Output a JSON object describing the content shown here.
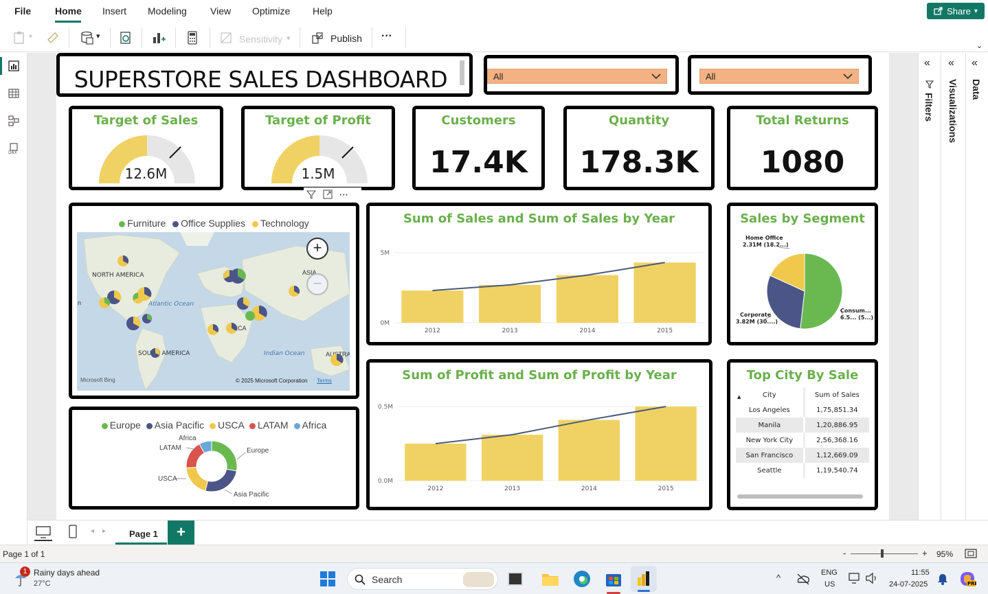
{
  "menubar": {
    "items": [
      "File",
      "Home",
      "Insert",
      "Modeling",
      "View",
      "Optimize",
      "Help"
    ],
    "active": "Home",
    "share_label": "Share"
  },
  "ribbon": {
    "sensitivity_label": "Sensitivity",
    "publish_label": "Publish",
    "more_label": "···"
  },
  "dashboard": {
    "title": "SUPERSTORE SALES DASHBOARD",
    "slicer1_value": "All",
    "slicer2_value": "All",
    "kpis": {
      "target_sales": {
        "title": "Target of Sales",
        "value": "12.6M"
      },
      "target_profit": {
        "title": "Target of Profit",
        "value": "1.5M"
      },
      "customers": {
        "title": "Customers",
        "value": "17.4K"
      },
      "quantity": {
        "title": "Quantity",
        "value": "178.3K"
      },
      "returns": {
        "title": "Total Returns",
        "value": "1080"
      }
    },
    "map": {
      "legend": [
        "Furniture",
        "Office Supplies",
        "Technology"
      ],
      "labels": {
        "north_america": "NORTH AMERICA",
        "south_america": "SOUTH AMERICA",
        "atlantic": "Atlantic Ocean",
        "indian": "Indian Ocean",
        "asia": "ASIA",
        "africa": "RICA",
        "austr": "AUSTRA",
        "left_n": "n"
      },
      "bing": "Microsoft Bing",
      "copyright": "© 2025 Microsoft Corporation",
      "terms": "Terms",
      "zoom_in": "+",
      "zoom_out": "−"
    },
    "donut": {
      "legend": [
        "Europe",
        "Asia Pacific",
        "USCA",
        "LATAM",
        "Africa"
      ],
      "labels": {
        "europe": "Europe",
        "asia": "Asia Pacific",
        "usca": "USCA",
        "latam": "LATAM",
        "africa": "Africa"
      }
    },
    "segment": {
      "title": "Sales by Segment",
      "home_office": "Home Office",
      "home_office_val": "2.31M (18.2...)",
      "corporate": "Corporate",
      "corporate_val": "3.82M (30....)",
      "consumer": "Consum...",
      "consumer_val": "6.5... (5...)"
    },
    "top_city": {
      "title": "Top City By Sale",
      "headers": [
        "City",
        "Sum of Sales"
      ],
      "rows": [
        [
          "Los Angeles",
          "1,75,851.34"
        ],
        [
          "Manila",
          "1,20,886.95"
        ],
        [
          "New York City",
          "2,56,368.16"
        ],
        [
          "San Francisco",
          "1,12,669.09"
        ],
        [
          "Seattle",
          "1,19,540.74"
        ]
      ]
    },
    "visual_header": {
      "more": "···"
    }
  },
  "chart_data": [
    {
      "type": "bar",
      "title": "Sum of Sales and Sum of Sales by Year",
      "categories": [
        "2012",
        "2013",
        "2014",
        "2015"
      ],
      "series": [
        {
          "values": [
            2.3,
            2.7,
            3.4,
            4.3
          ],
          "type": "bar",
          "color": "#f0d264"
        },
        {
          "values": [
            2.3,
            2.7,
            3.4,
            4.3
          ],
          "type": "line",
          "color": "#4b5a7d"
        }
      ],
      "yticks": [
        "0M",
        "5M"
      ],
      "ylim": [
        0,
        5
      ]
    },
    {
      "type": "bar",
      "title": "Sum of Profit and Sum of Profit by Year",
      "categories": [
        "2012",
        "2013",
        "2014",
        "2015"
      ],
      "series": [
        {
          "values": [
            0.25,
            0.31,
            0.41,
            0.5
          ],
          "type": "bar",
          "color": "#f0d264"
        },
        {
          "values": [
            0.25,
            0.31,
            0.41,
            0.5
          ],
          "type": "line",
          "color": "#4b5a7d"
        }
      ],
      "yticks": [
        "0.0M",
        "0.5M"
      ],
      "ylim": [
        0,
        0.5
      ]
    },
    {
      "type": "pie",
      "title": "Sales by Segment",
      "categories": [
        "Consumer",
        "Corporate",
        "Home Office"
      ],
      "values": [
        51.8,
        30.0,
        18.2
      ],
      "colors": [
        "#6ab950",
        "#4b5587",
        "#f0c84b"
      ]
    },
    {
      "type": "pie",
      "categories": [
        "Europe",
        "Asia Pacific",
        "USCA",
        "LATAM",
        "Africa"
      ],
      "values": [
        28,
        26,
        20,
        18,
        8
      ],
      "colors": [
        "#6ab950",
        "#4b5587",
        "#f0c84b",
        "#d9534f",
        "#6aa8d8"
      ]
    }
  ],
  "panes": {
    "filters": "Filters",
    "visualizations": "Visualizations",
    "data": "Data"
  },
  "pagebar": {
    "page_tab": "Page 1",
    "add": "+"
  },
  "status": {
    "page_info": "Page 1 of 1",
    "zoom": "95%",
    "minus": "-",
    "plus": "+"
  },
  "taskbar": {
    "weather_title": "Rainy days ahead",
    "weather_temp": "27°C",
    "weather_badge": "1",
    "search": "Search",
    "lang1": "ENG",
    "lang2": "US",
    "time": "11:55",
    "date": "24-07-2025"
  },
  "colors": {
    "accent": "#117865",
    "title_green": "#6ab04c",
    "bar_yellow": "#f0d264",
    "slicer": "#f4b183"
  }
}
